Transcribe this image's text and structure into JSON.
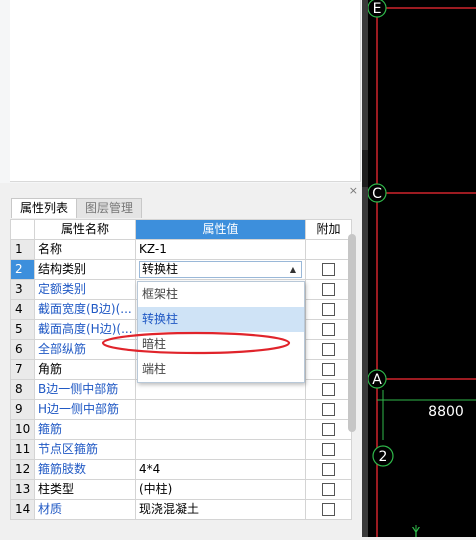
{
  "tabs": {
    "properties": "属性列表",
    "layers": "图层管理"
  },
  "close_glyph": "×",
  "grid": {
    "headers": {
      "name": "属性名称",
      "value": "属性值",
      "extra": "附加"
    },
    "rows": [
      {
        "num": "1",
        "name": "名称",
        "value": "KZ-1",
        "has_check": false
      },
      {
        "num": "2",
        "name": "结构类别",
        "value": "转换柱",
        "has_check": true
      },
      {
        "num": "3",
        "name": "定额类别",
        "value": "",
        "has_check": true
      },
      {
        "num": "4",
        "name": "截面宽度(B边)(...",
        "value": "",
        "has_check": true
      },
      {
        "num": "5",
        "name": "截面高度(H边)(...",
        "value": "",
        "has_check": true
      },
      {
        "num": "6",
        "name": "全部纵筋",
        "value": "",
        "has_check": true
      },
      {
        "num": "7",
        "name": "角筋",
        "value": "",
        "has_check": true
      },
      {
        "num": "8",
        "name": "B边一侧中部筋",
        "value": "",
        "has_check": true
      },
      {
        "num": "9",
        "name": "H边一侧中部筋",
        "value": "",
        "has_check": true
      },
      {
        "num": "10",
        "name": "箍筋",
        "value": "",
        "has_check": true
      },
      {
        "num": "11",
        "name": "节点区箍筋",
        "value": "",
        "has_check": true
      },
      {
        "num": "12",
        "name": "箍筋肢数",
        "value": "4*4",
        "has_check": true
      },
      {
        "num": "13",
        "name": "柱类型",
        "value": "(中柱)",
        "has_check": true
      },
      {
        "num": "14",
        "name": "材质",
        "value": "现浇混凝土",
        "has_check": true
      }
    ]
  },
  "dropdown": {
    "options": [
      "框架柱",
      "转换柱",
      "暗柱",
      "端柱"
    ],
    "highlighted": "转换柱"
  },
  "cad": {
    "axis_labels": {
      "top": "E",
      "middle": "C",
      "bottom": "A",
      "number": "2"
    },
    "dimension": "8800",
    "y_axis": "Y",
    "colors": {
      "grid_line": "#d0242c",
      "dimension_line": "#2fb84a",
      "text": "#ffffff"
    }
  }
}
